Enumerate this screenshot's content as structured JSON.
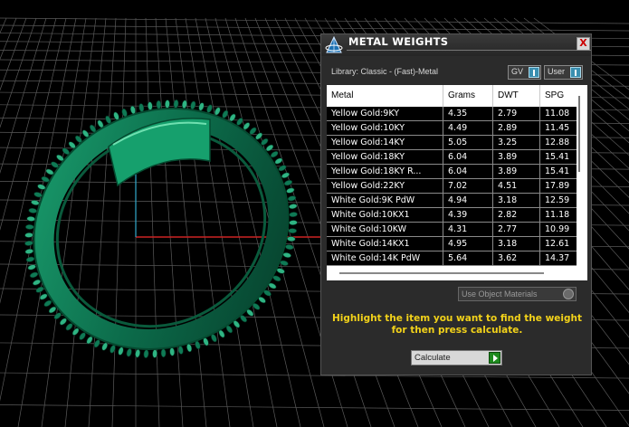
{
  "dialog": {
    "title": "METAL WEIGHTS",
    "close_glyph": "X",
    "library_label": "Library: Classic - (Fast)-Metal",
    "toggles": [
      {
        "label": "GV"
      },
      {
        "label": "User"
      }
    ],
    "table": {
      "columns": [
        "Metal",
        "Grams",
        "DWT",
        "SPG"
      ],
      "rows": [
        [
          "Yellow Gold:9KY",
          "4.35",
          "2.79",
          "11.08"
        ],
        [
          "Yellow Gold:10KY",
          "4.49",
          "2.89",
          "11.45"
        ],
        [
          "Yellow Gold:14KY",
          "5.05",
          "3.25",
          "12.88"
        ],
        [
          "Yellow Gold:18KY",
          "6.04",
          "3.89",
          "15.41"
        ],
        [
          "Yellow Gold:18KY R...",
          "6.04",
          "3.89",
          "15.41"
        ],
        [
          "Yellow Gold:22KY",
          "7.02",
          "4.51",
          "17.89"
        ],
        [
          "White Gold:9K PdW",
          "4.94",
          "3.18",
          "12.59"
        ],
        [
          "White Gold:10KX1",
          "4.39",
          "2.82",
          "11.18"
        ],
        [
          "White Gold:10KW",
          "4.31",
          "2.77",
          "10.99"
        ],
        [
          "White Gold:14KX1",
          "4.95",
          "3.18",
          "12.61"
        ],
        [
          "White Gold:14K PdW",
          "5.64",
          "3.62",
          "14.37"
        ]
      ]
    },
    "use_object_materials": "Use Object Materials",
    "hint": "Highlight the item you want to find the weight for then press calculate.",
    "calculate_label": "Calculate"
  },
  "colors": {
    "ring": "#0f7a55",
    "ring_highlight": "#2fb483",
    "grid": "#5a5a5a",
    "axis_x": "#cc2222",
    "axis_y": "#33aacc",
    "hint_text": "#f2d21a"
  },
  "icons": {
    "title": "pyramid-logo-icon",
    "close": "close-icon",
    "toggle": "toggle-indicator-icon",
    "dropdown": "dropdown-knob-icon",
    "run": "play-arrow-icon"
  }
}
